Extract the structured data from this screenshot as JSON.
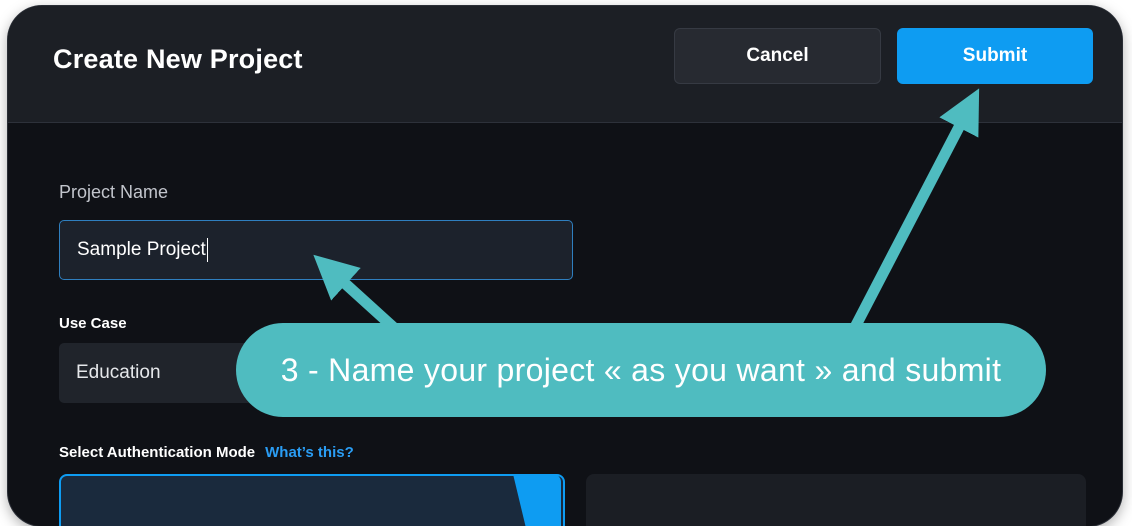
{
  "dialog": {
    "title": "Create New Project",
    "cancel_label": "Cancel",
    "submit_label": "Submit"
  },
  "form": {
    "project_name_label": "Project Name",
    "project_name_value": "Sample Project",
    "use_case_label": "Use Case",
    "use_case_value": "Education",
    "auth_mode_label": "Select Authentication Mode",
    "auth_help_link": "What’s this?"
  },
  "annotation": {
    "callout_text": "3 - Name your project « as you want » and submit",
    "accent_color": "#4fbcc0"
  },
  "colors": {
    "primary": "#0e9cf2",
    "background": "#0f1116",
    "header": "#1c1f25"
  }
}
